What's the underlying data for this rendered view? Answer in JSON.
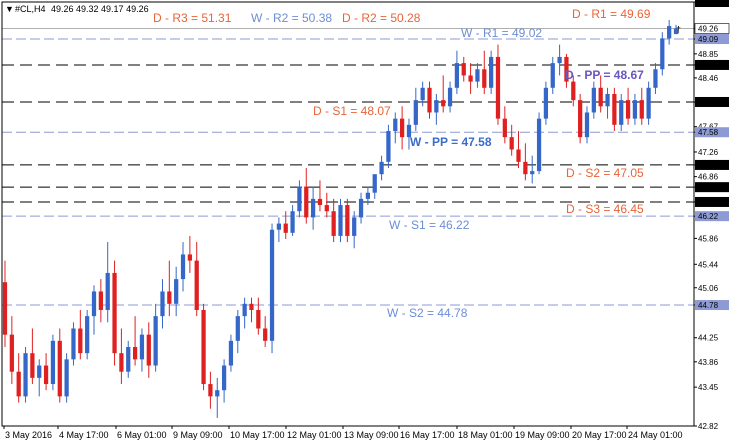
{
  "header": {
    "symbol": "#CL,H4",
    "ohlc": "49.26 49.32 49.17 49.26"
  },
  "chart_data": {
    "type": "candlestick",
    "ylim": [
      42.82,
      49.69
    ],
    "y_ticks": [
      "49.69",
      "49.26",
      "49.09",
      "48.85",
      "48.67",
      "48.46",
      "48.07",
      "47.67",
      "47.58",
      "47.26",
      "47.05",
      "46.86",
      "46.69",
      "46.45",
      "46.22",
      "45.86",
      "45.44",
      "45.06",
      "44.78",
      "44.25",
      "43.86",
      "43.45",
      "42.82"
    ],
    "x_labels": [
      "3 May 2016",
      "4 May 17:00",
      "6 May 01:00",
      "9 May 09:00",
      "10 May 17:00",
      "12 May 01:00",
      "13 May 09:00",
      "16 May 17:00",
      "18 May 01:00",
      "19 May 09:00",
      "20 May 17:00",
      "24 May 01:00"
    ],
    "colors": {
      "bull": "#3567c8",
      "bear": "#e02020",
      "daily_label": "#e8643a",
      "weekly_label": "#6b8ed6",
      "weekly_pp_label": "#3a6cc9",
      "daily_pp_label": "#6a56c0",
      "daily_line": "#000000",
      "weekly_line": "#8e9ad4"
    },
    "levels": [
      {
        "label": "D - R3 = 51.31",
        "kind": "daily"
      },
      {
        "label": "W - R2 = 50.38",
        "kind": "weekly"
      },
      {
        "label": "D - R2 = 50.28",
        "kind": "daily"
      },
      {
        "label": "D - R1 = 49.69",
        "kind": "daily",
        "price": 49.69
      },
      {
        "label": "W - R1 = 49.02",
        "kind": "weekly",
        "price": 49.09
      },
      {
        "label": "D - PP = 48.67",
        "kind": "daily_pp",
        "price": 48.67
      },
      {
        "label": "D - S1 = 48.07",
        "kind": "daily",
        "price": 48.07
      },
      {
        "label": "W - PP = 47.58",
        "kind": "weekly_pp",
        "price": 47.58
      },
      {
        "label": "D - S2 = 47.05",
        "kind": "daily",
        "price": 47.05
      },
      {
        "label": "D - S3 = 46.45",
        "kind": "daily",
        "price": 46.45
      },
      {
        "label": "W - S1 = 46.22",
        "kind": "weekly",
        "price": 46.22
      },
      {
        "label": "W - S2 = 44.78",
        "kind": "weekly",
        "price": 44.78
      }
    ],
    "extra_lines": [
      46.69
    ],
    "current_price": 49.26,
    "candles": [
      [
        45.15,
        45.5,
        44.1,
        44.3
      ],
      [
        44.3,
        44.6,
        43.5,
        43.7
      ],
      [
        43.7,
        44.0,
        43.2,
        43.3
      ],
      [
        43.3,
        44.1,
        43.2,
        44.0
      ],
      [
        44.0,
        44.4,
        43.5,
        43.6
      ],
      [
        43.6,
        43.9,
        43.3,
        43.8
      ],
      [
        43.8,
        44.0,
        43.4,
        43.5
      ],
      [
        43.5,
        44.3,
        43.4,
        44.2
      ],
      [
        44.2,
        44.4,
        43.2,
        43.3
      ],
      [
        43.3,
        44.0,
        43.2,
        43.9
      ],
      [
        43.9,
        44.5,
        43.8,
        44.4
      ],
      [
        44.4,
        44.7,
        43.9,
        44.0
      ],
      [
        44.0,
        44.7,
        43.9,
        44.6
      ],
      [
        44.6,
        45.1,
        44.3,
        45.0
      ],
      [
        45.0,
        45.2,
        44.5,
        44.7
      ],
      [
        44.7,
        45.8,
        44.5,
        45.3
      ],
      [
        45.3,
        45.5,
        43.8,
        44.0
      ],
      [
        44.0,
        44.4,
        43.5,
        43.7
      ],
      [
        43.7,
        44.2,
        43.6,
        44.1
      ],
      [
        44.1,
        44.6,
        43.8,
        43.9
      ],
      [
        43.9,
        44.4,
        43.7,
        44.3
      ],
      [
        44.3,
        44.5,
        43.6,
        43.8
      ],
      [
        43.8,
        44.8,
        43.7,
        44.6
      ],
      [
        44.6,
        45.2,
        44.4,
        45.0
      ],
      [
        45.0,
        45.5,
        44.6,
        44.8
      ],
      [
        44.8,
        45.4,
        44.6,
        45.2
      ],
      [
        45.2,
        45.8,
        45.0,
        45.6
      ],
      [
        45.6,
        45.9,
        45.3,
        45.5
      ],
      [
        45.5,
        45.8,
        44.6,
        44.7
      ],
      [
        44.7,
        44.8,
        43.4,
        43.5
      ],
      [
        43.5,
        43.7,
        43.1,
        43.3
      ],
      [
        43.3,
        43.6,
        42.95,
        43.4
      ],
      [
        43.4,
        43.9,
        43.2,
        43.8
      ],
      [
        43.8,
        44.3,
        43.7,
        44.2
      ],
      [
        44.2,
        44.7,
        44.0,
        44.6
      ],
      [
        44.6,
        44.9,
        44.4,
        44.8
      ],
      [
        44.8,
        44.9,
        44.5,
        44.7
      ],
      [
        44.7,
        44.9,
        44.3,
        44.4
      ],
      [
        44.4,
        44.6,
        44.1,
        44.2
      ],
      [
        44.2,
        46.1,
        44.0,
        46.0
      ],
      [
        46.0,
        46.2,
        45.8,
        46.1
      ],
      [
        46.1,
        46.3,
        45.85,
        45.95
      ],
      [
        45.95,
        46.4,
        45.9,
        46.3
      ],
      [
        46.3,
        46.8,
        46.2,
        46.7
      ],
      [
        46.7,
        47.0,
        46.1,
        46.2
      ],
      [
        46.2,
        46.7,
        46.0,
        46.5
      ],
      [
        46.5,
        46.8,
        46.3,
        46.4
      ],
      [
        46.4,
        46.6,
        46.2,
        46.3
      ],
      [
        46.3,
        46.5,
        45.8,
        45.9
      ],
      [
        45.9,
        46.5,
        45.8,
        46.4
      ],
      [
        46.4,
        46.5,
        45.8,
        45.9
      ],
      [
        45.9,
        46.3,
        45.7,
        46.2
      ],
      [
        46.2,
        46.6,
        46.1,
        46.5
      ],
      [
        46.5,
        46.7,
        46.4,
        46.6
      ],
      [
        46.6,
        46.8,
        46.5,
        46.9
      ],
      [
        46.9,
        47.2,
        46.8,
        47.1
      ],
      [
        47.1,
        47.7,
        47.0,
        47.6
      ],
      [
        47.6,
        47.9,
        47.4,
        47.8
      ],
      [
        47.8,
        48.0,
        47.3,
        47.5
      ],
      [
        47.5,
        47.8,
        47.3,
        47.7
      ],
      [
        47.7,
        48.3,
        47.6,
        48.1
      ],
      [
        48.1,
        48.4,
        48.0,
        48.3
      ],
      [
        48.3,
        48.4,
        47.8,
        47.9
      ],
      [
        47.9,
        48.2,
        47.7,
        48.1
      ],
      [
        48.1,
        48.5,
        47.9,
        48.0
      ],
      [
        48.0,
        48.4,
        47.9,
        48.3
      ],
      [
        48.3,
        48.9,
        48.2,
        48.7
      ],
      [
        48.7,
        48.8,
        48.4,
        48.5
      ],
      [
        48.5,
        48.7,
        48.2,
        48.4
      ],
      [
        48.4,
        48.7,
        48.3,
        48.6
      ],
      [
        48.6,
        48.9,
        48.2,
        48.3
      ],
      [
        48.3,
        48.9,
        48.2,
        48.8
      ],
      [
        48.8,
        49.0,
        47.7,
        47.8
      ],
      [
        47.8,
        48.0,
        47.4,
        47.5
      ],
      [
        47.5,
        47.7,
        47.2,
        47.3
      ],
      [
        47.3,
        47.6,
        47.0,
        47.1
      ],
      [
        47.1,
        47.4,
        46.8,
        46.9
      ],
      [
        46.9,
        47.2,
        46.75,
        46.95
      ],
      [
        46.95,
        47.9,
        46.9,
        47.8
      ],
      [
        47.8,
        48.4,
        47.7,
        48.3
      ],
      [
        48.3,
        48.8,
        48.2,
        48.7
      ],
      [
        48.7,
        49.0,
        48.5,
        48.8
      ],
      [
        48.8,
        48.85,
        48.3,
        48.4
      ],
      [
        48.4,
        48.5,
        48.0,
        48.1
      ],
      [
        48.1,
        48.2,
        47.4,
        47.5
      ],
      [
        47.5,
        48.0,
        47.4,
        47.9
      ],
      [
        47.9,
        48.4,
        47.8,
        48.3
      ],
      [
        48.3,
        48.5,
        47.9,
        48.0
      ],
      [
        48.0,
        48.3,
        47.8,
        48.2
      ],
      [
        48.2,
        48.3,
        47.6,
        47.7
      ],
      [
        47.7,
        48.2,
        47.6,
        48.1
      ],
      [
        48.1,
        48.3,
        47.7,
        47.8
      ],
      [
        47.8,
        48.2,
        47.7,
        48.1
      ],
      [
        48.1,
        48.3,
        47.7,
        47.8
      ],
      [
        47.8,
        48.4,
        47.7,
        48.3
      ],
      [
        48.3,
        48.7,
        48.2,
        48.6
      ],
      [
        48.6,
        49.2,
        48.5,
        49.1
      ],
      [
        49.1,
        49.4,
        49.0,
        49.3
      ],
      [
        49.17,
        49.32,
        49.17,
        49.26
      ]
    ]
  }
}
